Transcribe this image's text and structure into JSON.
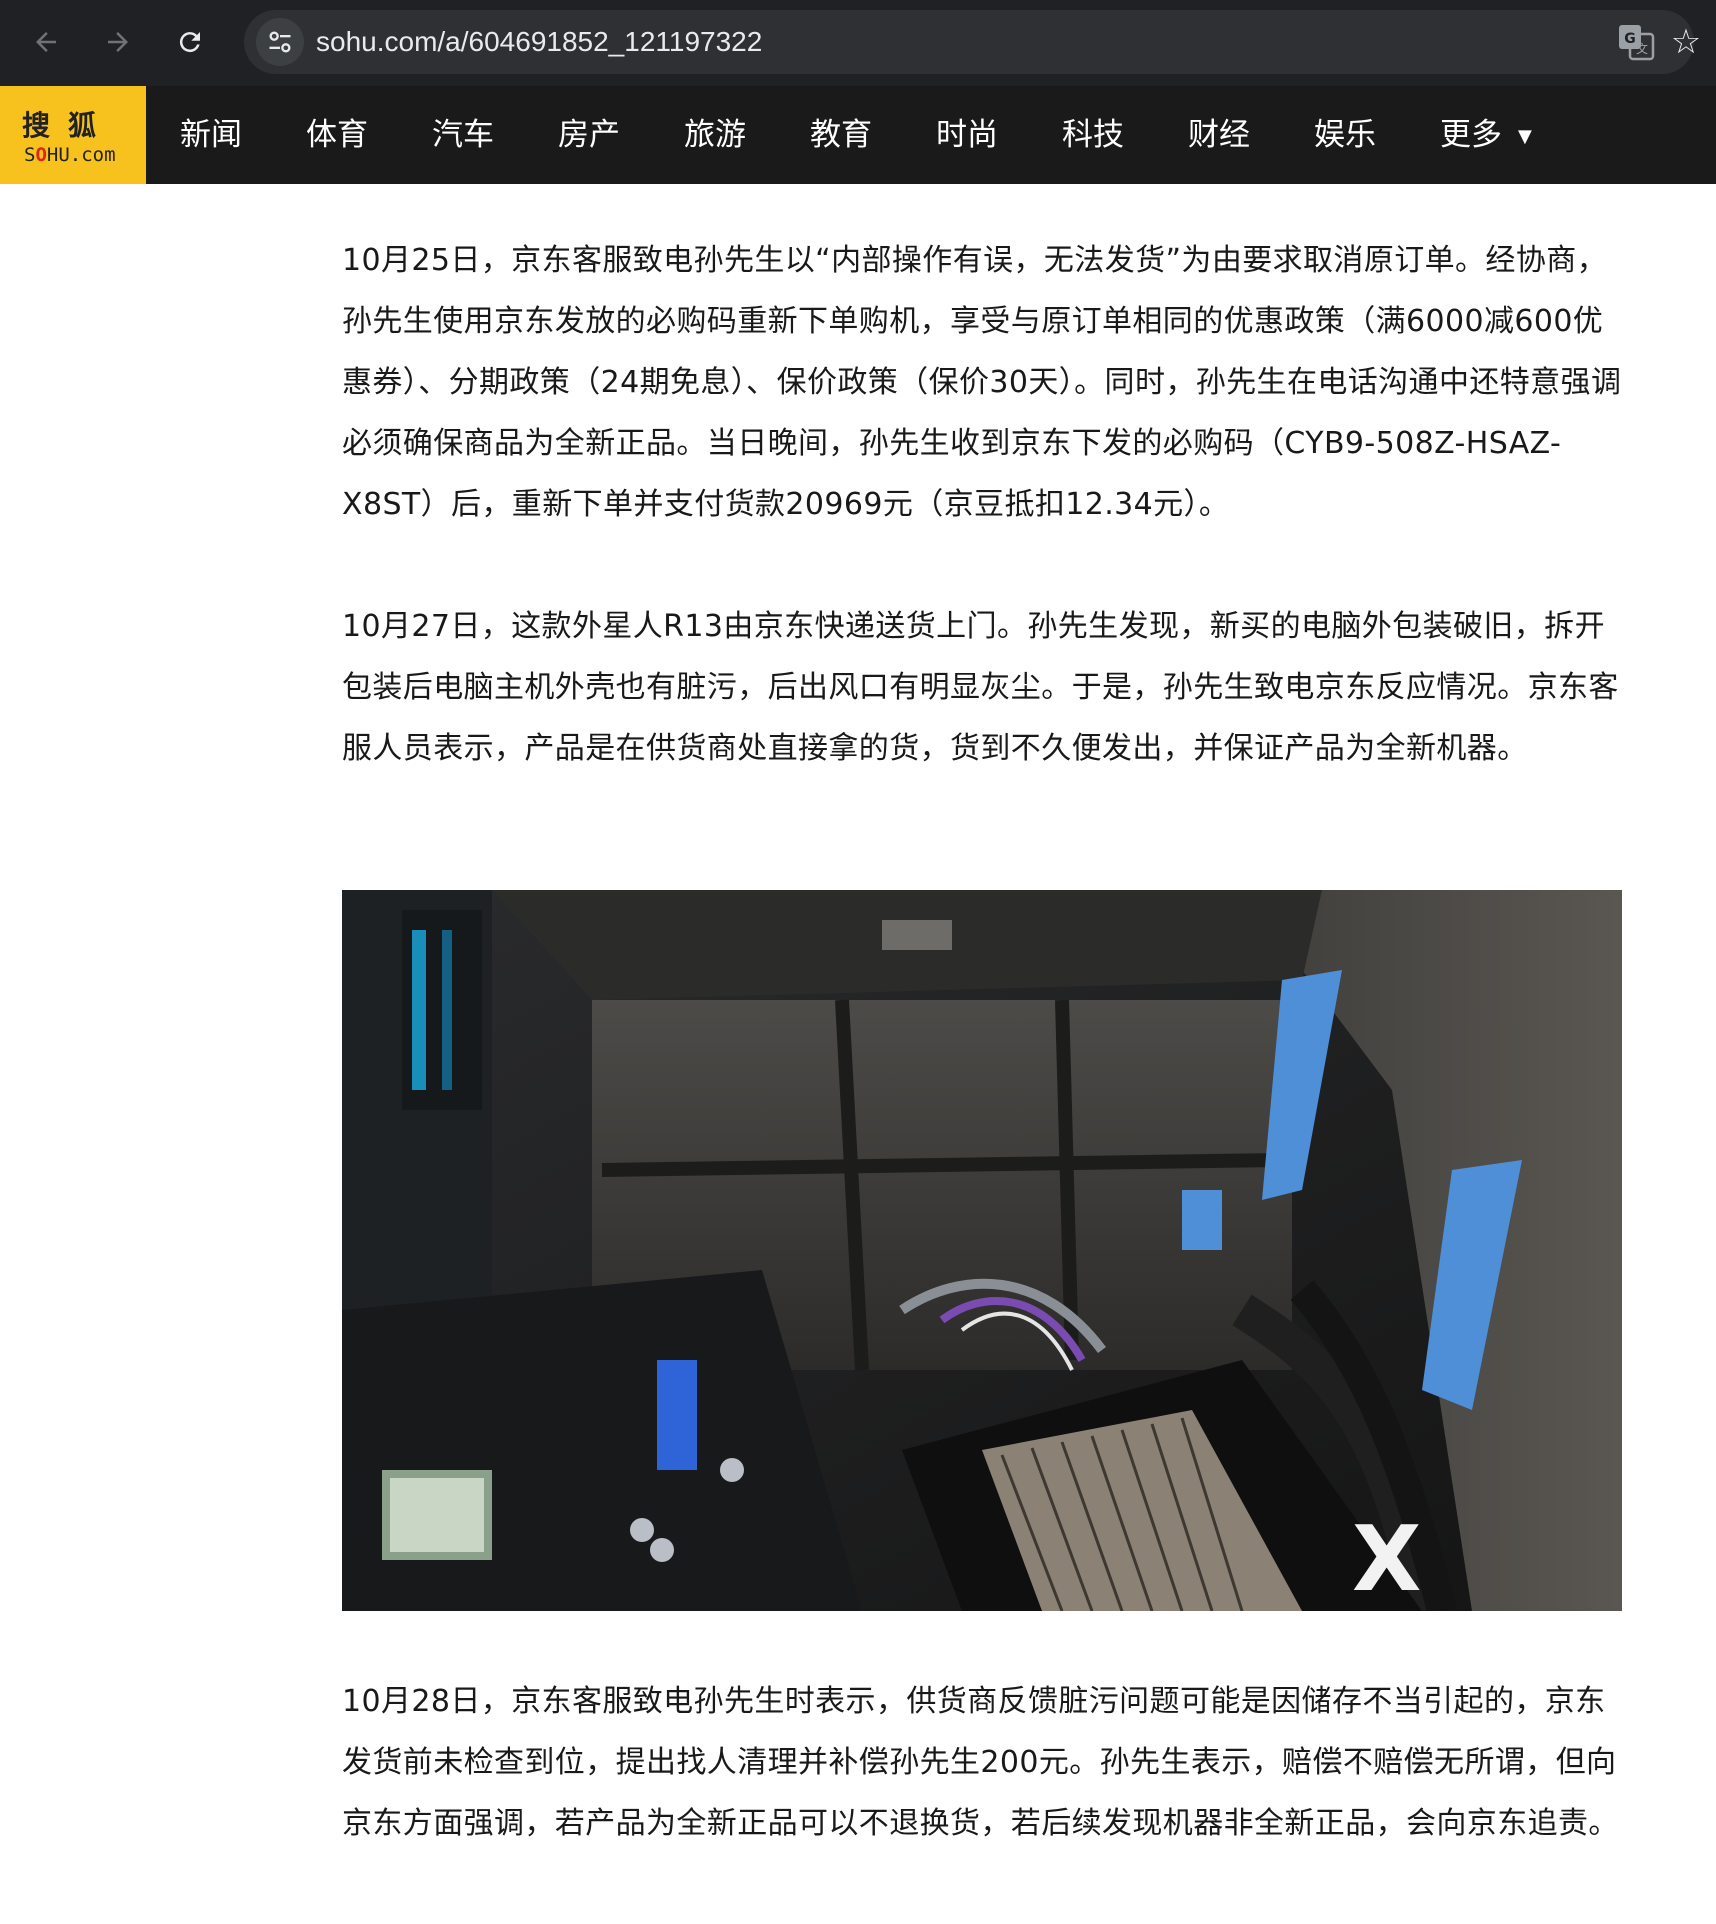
{
  "browser": {
    "url": "sohu.com/a/604691852_121197322",
    "back_icon": "arrow-left-icon",
    "forward_icon": "arrow-right-icon",
    "reload_icon": "reload-icon",
    "site_info_icon": "tune-icon",
    "translate_icon": "translate-icon",
    "bookmark_icon": "star-icon"
  },
  "site": {
    "logo_cn": "搜狐",
    "logo_en_pre": "S",
    "logo_en_dot": "O",
    "logo_en_post": "HU.com",
    "brand_color": "#f7c21d",
    "nav": [
      "新闻",
      "体育",
      "汽车",
      "房产",
      "旅游",
      "教育",
      "时尚",
      "科技",
      "财经",
      "娱乐"
    ],
    "more_label": "更多"
  },
  "article": {
    "paragraphs": [
      "10月25日，京东客服致电孙先生以“内部操作有误，无法发货”为由要求取消原订单。经协商，孙先生使用京东发放的必购码重新下单购机，享受与原订单相同的优惠政策（满6000减600优惠券）、分期政策（24期免息）、保价政策（保价30天）。同时，孙先生在电话沟通中还特意强调必须确保商品为全新正品。当日晚间，孙先生收到京东下发的必购码（CYB9-508Z-HSAZ-X8ST）后，重新下单并支付货款20969元（京豆抵扣12.34元）。",
      "10月27日，这款外星人R13由京东快递送货上门。孙先生发现，新买的电脑外包装破旧，拆开包装后电脑主机外壳也有脏污，后出风口有明显灰尘。于是，孙先生致电京东反应情况。京东客服人员表示，产品是在供货商处直接拿的货，货到不久便发出，并保证产品为全新机器。",
      "10月28日，京东客服致电孙先生时表示，供货商反馈脏污问题可能是因储存不当引起的，京东发货前未检查到位，提出找人清理并补偿孙先生200元。孙先生表示，赔偿不赔偿无所谓，但向京东方面强调，若产品为全新正品可以不退换货，若后续发现机器非全新正品，会向京东追责。"
    ]
  }
}
